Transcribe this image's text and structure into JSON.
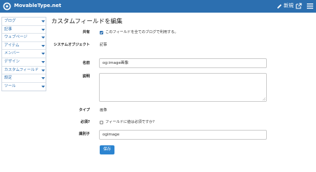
{
  "header": {
    "site_name": "MovableType.net",
    "new_label": "新規"
  },
  "sidebar": {
    "items": [
      {
        "label": "ブログ"
      },
      {
        "label": "記事"
      },
      {
        "label": "ウェブページ"
      },
      {
        "label": "アイテム"
      },
      {
        "label": "メンバー"
      },
      {
        "label": "デザイン"
      },
      {
        "label": "カスタムフィールド"
      },
      {
        "label": "設定"
      },
      {
        "label": "ツール"
      }
    ]
  },
  "page": {
    "title": "カスタムフィールドを編集"
  },
  "form": {
    "shared": {
      "label": "共有",
      "checkbox_text": "このフィールドを全てのブログで利用する。",
      "checked": true
    },
    "system_object": {
      "label": "システムオブジェクト",
      "value": "記事"
    },
    "name": {
      "label": "名前",
      "value": "og:image画像"
    },
    "description": {
      "label": "説明",
      "value": ""
    },
    "type": {
      "label": "タイプ",
      "value": "画像"
    },
    "required": {
      "label": "必須?",
      "checkbox_text": "フィールドに値は必須ですか?",
      "checked": false
    },
    "identifier": {
      "label": "識別子",
      "value": "ogimage"
    },
    "save_label": "保存"
  },
  "colors": {
    "brand": "#2c6fb0",
    "button": "#2c84d0"
  }
}
